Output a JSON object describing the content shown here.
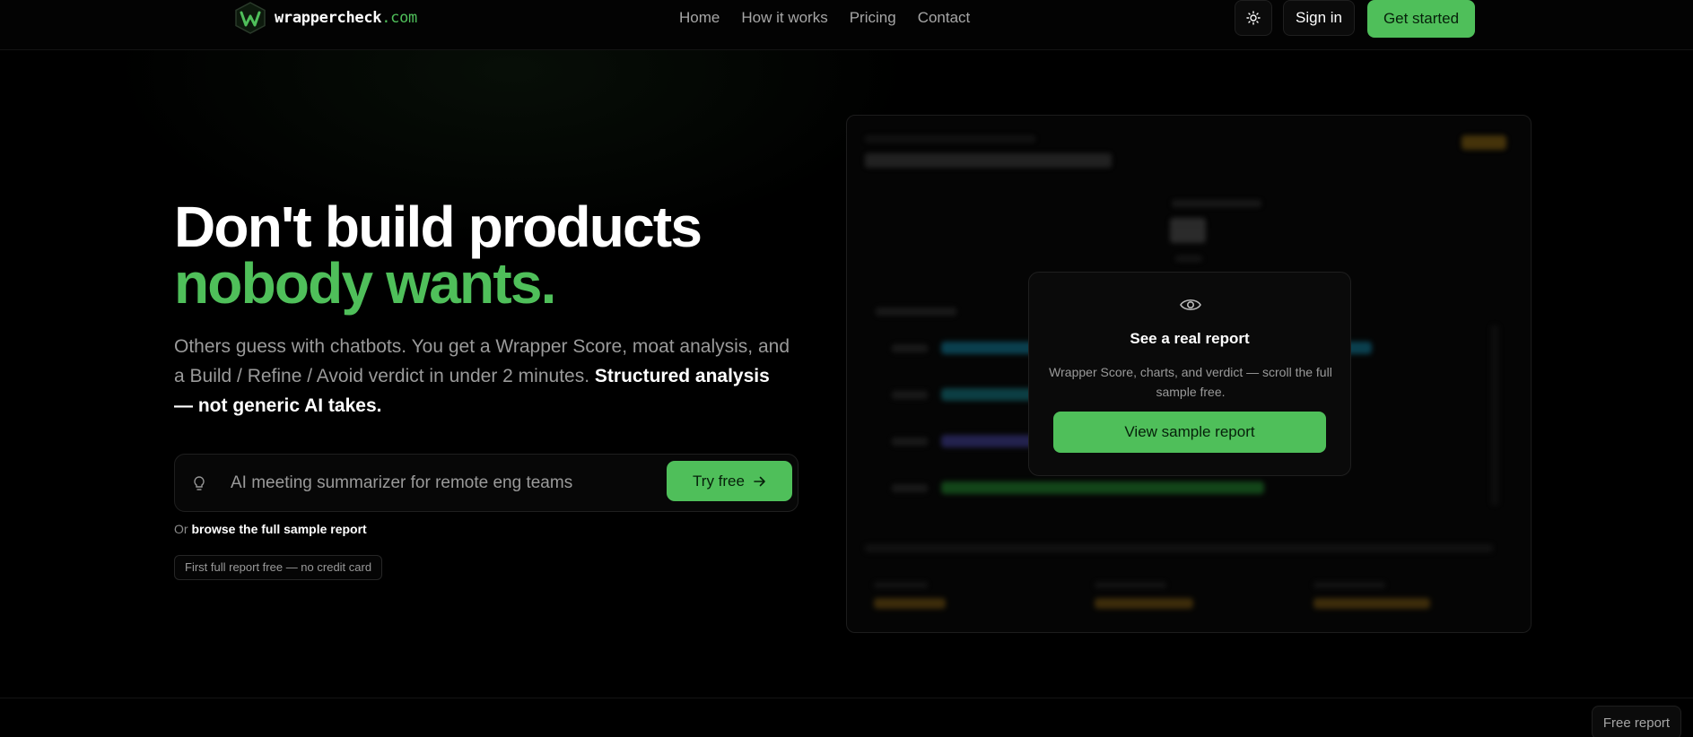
{
  "brand": {
    "name": "wrappercheck",
    "tld": ".com"
  },
  "nav": {
    "items": [
      "Home",
      "How it works",
      "Pricing",
      "Contact"
    ]
  },
  "header": {
    "theme_icon": "sun-icon",
    "signin_label": "Sign in",
    "get_started_label": "Get started"
  },
  "hero": {
    "title_line1": "Don't build products",
    "title_line2": "nobody wants.",
    "subtitle": "Others guess with chatbots. You get a Wrapper Score, moat analysis, and a Build / Refine / Avoid verdict in under 2 minutes.",
    "subtitle_strong": "Structured analysis — not generic AI takes.",
    "input_placeholder": "AI meeting summarizer for remote eng teams",
    "input_icon": "lightbulb-icon",
    "try_label": "Try free",
    "or_text": "Or",
    "browse_link": "browse the full sample report",
    "badge": "First full report free — no credit card"
  },
  "preview_card": {
    "icon": "eye-icon",
    "title": "See a real report",
    "description": "Wrapper Score, charts, and verdict — scroll the full sample free.",
    "button_label": "View sample report"
  },
  "footer": {
    "free_report_label": "Free report"
  },
  "colors": {
    "accent": "#4fbf5a",
    "background": "#000000",
    "muted": "#9a9a9a"
  }
}
